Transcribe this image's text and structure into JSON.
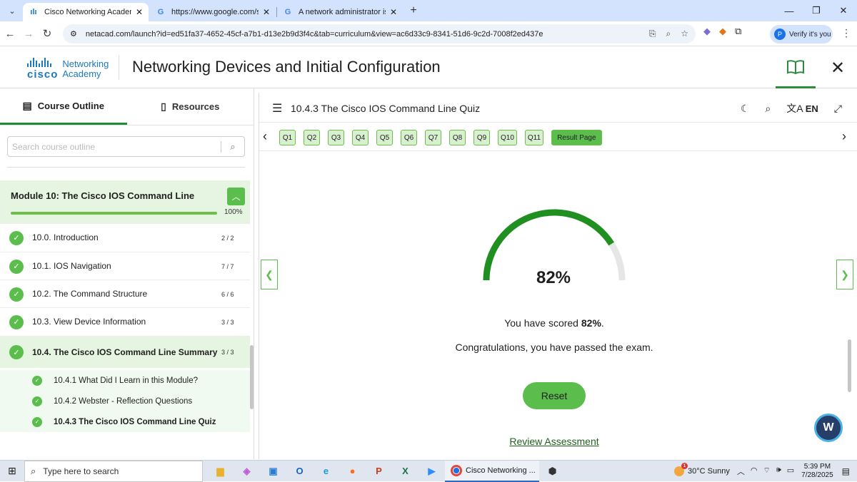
{
  "browser": {
    "tabs": [
      {
        "title": "Cisco Networking Academy: Ne",
        "icon": "cisco-icon",
        "active": true
      },
      {
        "title": "https://www.google.com/searc",
        "icon": "google-icon",
        "active": false
      },
      {
        "title": "A network administrator is wor",
        "icon": "google-icon",
        "active": false
      }
    ],
    "url": "netacad.com/launch?id=ed51fa37-4652-45cf-a7b1-d13e2b9d3f4c&tab=curriculum&view=ac6d33c9-8341-51d6-9c2d-7008f2ed437e",
    "profile_label": "Verify it's you",
    "profile_initial": "P"
  },
  "header": {
    "logo_cisco": "cisco",
    "logo_line1": "Networking",
    "logo_line2": "Academy",
    "course_title": "Networking Devices and Initial Configuration"
  },
  "sidebar": {
    "tabs": [
      "Course Outline",
      "Resources"
    ],
    "search_placeholder": "Search course outline",
    "module": {
      "title": "Module 10: The Cisco IOS Command Line",
      "progress_label": "100%",
      "progress": 1.0
    },
    "lessons": [
      {
        "title": "10.0. Introduction",
        "count": "2 / 2"
      },
      {
        "title": "10.1. IOS Navigation",
        "count": "7 / 7"
      },
      {
        "title": "10.2. The Command Structure",
        "count": "6 / 6"
      },
      {
        "title": "10.3. View Device Information",
        "count": "3 / 3"
      },
      {
        "title": "10.4. The Cisco IOS Command Line Summary",
        "count": "3 / 3"
      }
    ],
    "sublessons": [
      {
        "title": "10.4.1 What Did I Learn in this Module?"
      },
      {
        "title": "10.4.2 Webster - Reflection Questions"
      },
      {
        "title": "10.4.3 The Cisco IOS Command Line Quiz"
      }
    ]
  },
  "main": {
    "title": "10.4.3 The Cisco IOS Command Line Quiz",
    "language": "EN",
    "questions": [
      "Q1",
      "Q2",
      "Q3",
      "Q4",
      "Q5",
      "Q6",
      "Q7",
      "Q8",
      "Q9",
      "Q10",
      "Q11"
    ],
    "result_label": "Result Page",
    "score_percent": 82,
    "score_label": "82%",
    "score_text_prefix": "You have scored ",
    "score_text_value": "82%",
    "score_text_suffix": ".",
    "congrats": "Congratulations, you have passed the exam.",
    "reset_label": "Reset",
    "review_label": "Review Assessment",
    "colors": {
      "accent": "#5bbd4c",
      "gauge_fill": "#1f8f1f",
      "gauge_track": "#e6e6e6"
    }
  },
  "taskbar": {
    "search_placeholder": "Type here to search",
    "active_app": "Cisco Networking ...",
    "weather": "30°C  Sunny",
    "weather_badge": "1",
    "time": "5:39 PM",
    "date": "7/28/2025"
  }
}
